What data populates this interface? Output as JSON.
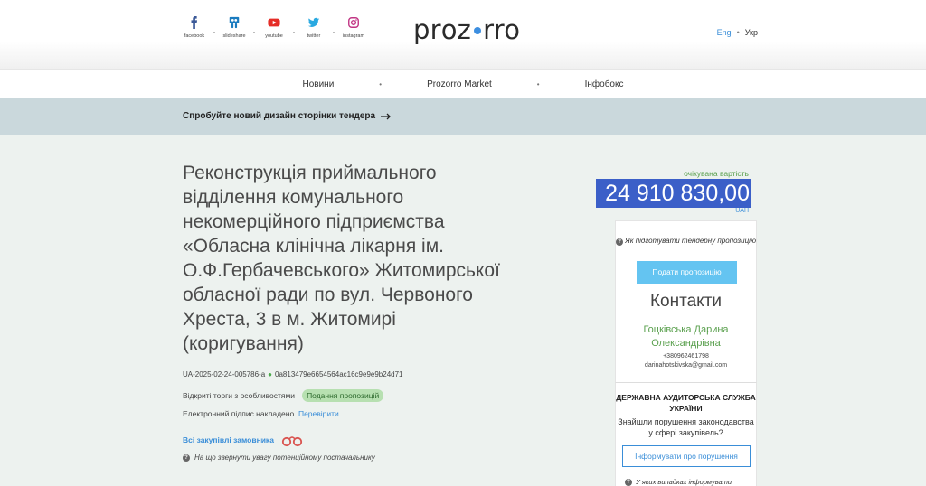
{
  "social": [
    {
      "label": "facebook",
      "icon": "facebook-icon",
      "color": "#3b5998"
    },
    {
      "label": "slideshare",
      "icon": "slideshare-icon",
      "color": "#1a7bbf"
    },
    {
      "label": "youtube",
      "icon": "youtube-icon",
      "color": "#e52d27"
    },
    {
      "label": "twitter",
      "icon": "twitter-icon",
      "color": "#29a9e1"
    },
    {
      "label": "instagram",
      "icon": "instagram-icon",
      "color": "#c13584"
    }
  ],
  "logo": {
    "left": "prоz",
    "right": "rro"
  },
  "lang": {
    "en": "Eng",
    "uk": "Укр"
  },
  "nav": {
    "news": "Новини",
    "market": "Prozorro Market",
    "infobox": "Інфобокс"
  },
  "banner": {
    "text": "Спробуйте новий дизайн сторінки тендера"
  },
  "tender": {
    "title": "Реконструкція приймального відділення комунального некомерційного підприємства «Обласна клінічна лікарня ім. О.Ф.Гербачевського» Житомирської обласної ради по вул. Червоного Хреста, 3 в м. Житомирі (коригування)",
    "id": "UA-2025-02-24-005786-a",
    "hash": "0a813479e6654564ac16c9e9e9b24d71",
    "procedure": "Відкриті торги з особливостями",
    "status": "Подання пропозицій",
    "signature": "Електронний підпис накладено.",
    "verify": "Перевірити",
    "all_purchases": "Всі закупівлі замовника",
    "attention": "На що звернути увагу потенційному постачальнику"
  },
  "value": {
    "label": "очікувана вартість",
    "amount": "24 910 830,00",
    "currency": "UAH"
  },
  "side": {
    "how_to": "Як підготувати тендерну пропозицію",
    "submit": "Подати пропозицію",
    "contacts_title": "Контакти",
    "contact_name": "Гоцківська Дарина Олександрівна",
    "phone": "+380962461798",
    "email": "darinahotskivska@gmail.com",
    "audit_org": "ДЕРЖАВНА АУДИТОРСЬКА СЛУЖБА УКРАЇНИ",
    "audit_question": "Знайшли порушення законодавства у сфері закупівель?",
    "report_button": "Інформувати про порушення",
    "cases": "У яких випадках інформувати"
  }
}
